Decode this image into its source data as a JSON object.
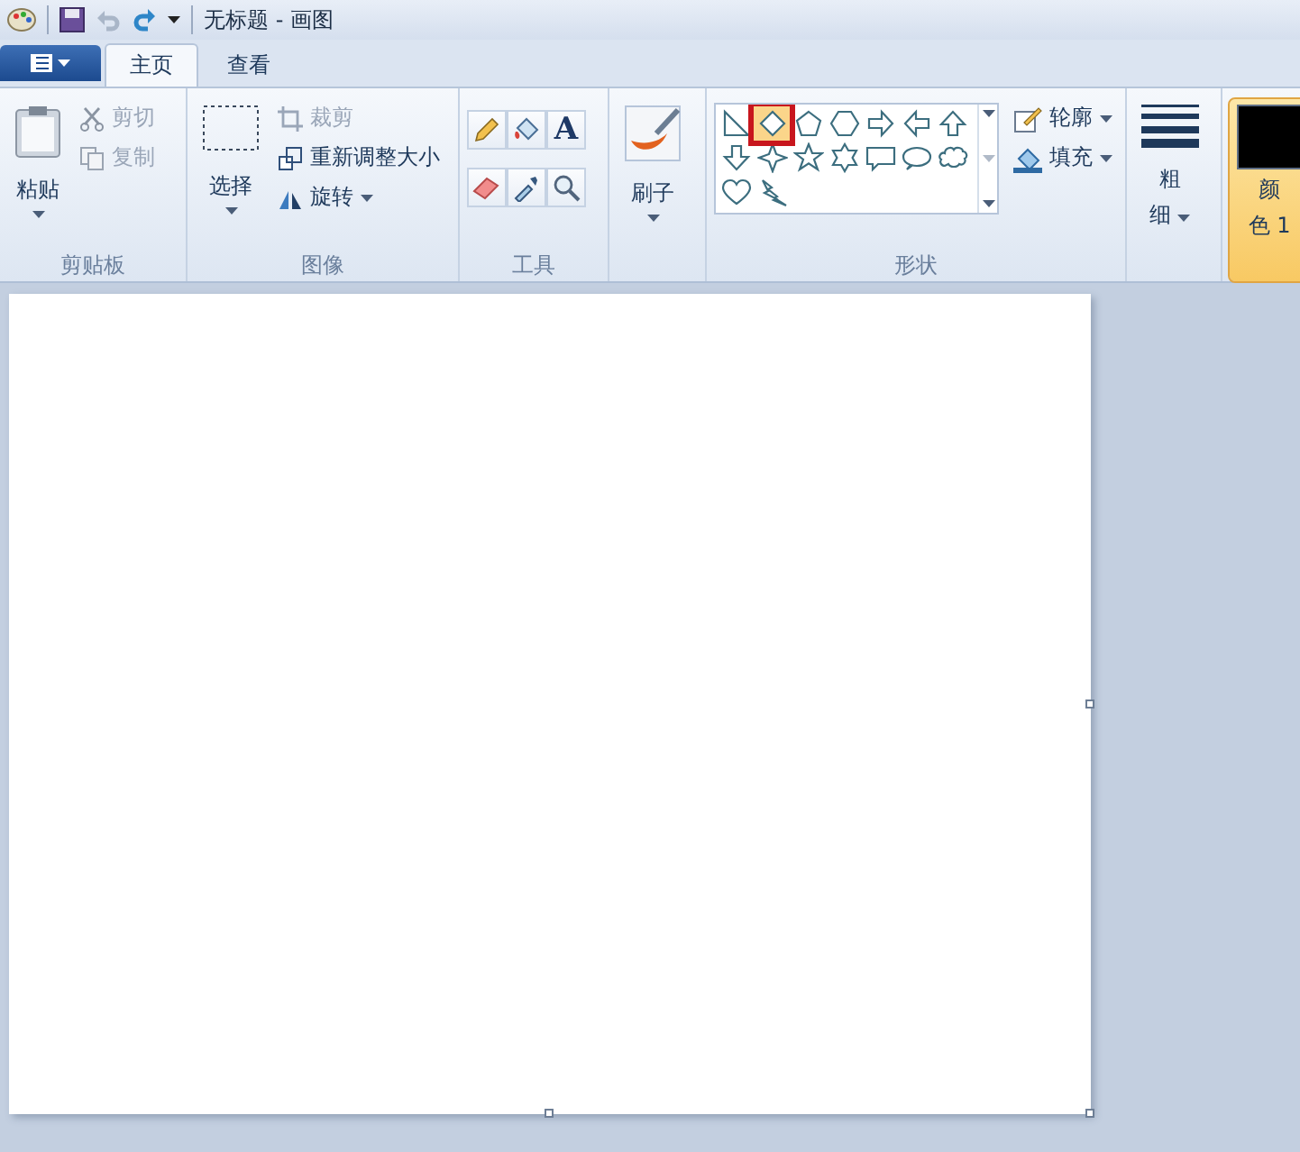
{
  "window": {
    "title": "无标题 - 画图"
  },
  "tabs": [
    {
      "label": "主页",
      "selected": true
    },
    {
      "label": "查看",
      "selected": false
    }
  ],
  "clipboard": {
    "label": "剪贴板",
    "paste": "粘贴",
    "cut": {
      "label": "剪切",
      "disabled": true
    },
    "copy": {
      "label": "复制",
      "disabled": true
    }
  },
  "image": {
    "label": "图像",
    "select": "选择",
    "crop": {
      "label": "裁剪",
      "disabled": true
    },
    "resize": {
      "label": "重新调整大小",
      "disabled": false
    },
    "rotate": {
      "label": "旋转",
      "disabled": false
    }
  },
  "tools": {
    "label": "工具",
    "items": [
      {
        "kind": "pencil"
      },
      {
        "kind": "fill"
      },
      {
        "kind": "text",
        "glyph": "A"
      },
      {
        "kind": "eraser"
      },
      {
        "kind": "picker"
      },
      {
        "kind": "magnifier"
      }
    ]
  },
  "brushes": {
    "label": "刷子"
  },
  "shapes": {
    "label": "形状",
    "items": [
      {
        "kind": "right-triangle",
        "selected": false
      },
      {
        "kind": "diamond",
        "selected": true
      },
      {
        "kind": "pentagon",
        "selected": false
      },
      {
        "kind": "hexagon",
        "selected": false
      },
      {
        "kind": "arrow-right",
        "selected": false
      },
      {
        "kind": "arrow-left",
        "selected": false
      },
      {
        "kind": "arrow-up",
        "selected": false
      },
      {
        "kind": "arrow-down",
        "selected": false
      },
      {
        "kind": "star4",
        "selected": false
      },
      {
        "kind": "star5",
        "selected": false
      },
      {
        "kind": "star6",
        "selected": false
      },
      {
        "kind": "callout-rect",
        "selected": false
      },
      {
        "kind": "callout-oval",
        "selected": false
      },
      {
        "kind": "callout-cloud",
        "selected": false
      },
      {
        "kind": "heart",
        "selected": false
      },
      {
        "kind": "lightning",
        "selected": false
      }
    ],
    "outline": "轮廓",
    "fill": "填充"
  },
  "size": {
    "label_1": "粗",
    "label_2": "细"
  },
  "color1": {
    "label_1": "颜",
    "label_2": "色 1",
    "selected": true,
    "color": "#000000"
  }
}
